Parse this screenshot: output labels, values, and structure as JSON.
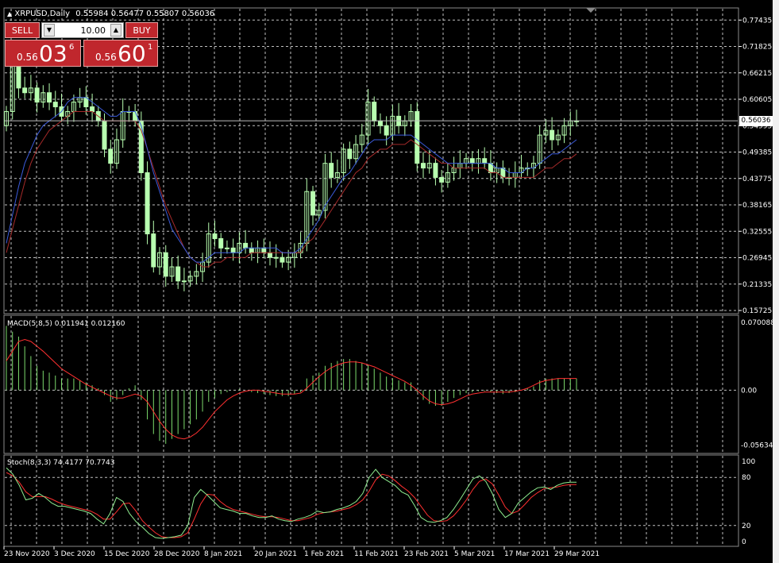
{
  "header": {
    "title": "XRPUSD,Daily",
    "ohlc": "0.55984 0.56477 0.55807 0.56036"
  },
  "trade_panel": {
    "sell_label": "SELL",
    "buy_label": "BUY",
    "volume": "10.00",
    "sell_price": {
      "small": "0.56",
      "big": "03",
      "pip": "6"
    },
    "buy_price": {
      "small": "0.56",
      "big": "60",
      "pip": "1"
    }
  },
  "colors": {
    "background": "#000000",
    "grid": "#ffffff",
    "bull_candle": "#b8ffb0",
    "wick": "#ffffff",
    "ma_fast": "#3b5bdb",
    "ma_slow": "#a52a2a",
    "histogram": "#7ddc6d",
    "signal": "#ff3030",
    "stoch_main": "#90ee90",
    "stoch_signal": "#ff3030",
    "trade_red": "#c0272d"
  },
  "current_price_label": "0.56036",
  "chart_data": [
    {
      "type": "candlestick",
      "title": "XRPUSD,Daily",
      "ylim": [
        0.15725,
        0.79
      ],
      "y_ticks": [
        "0.77435",
        "0.71825",
        "0.66215",
        "0.60605",
        "0.54995",
        "0.49385",
        "0.43775",
        "0.38165",
        "0.32555",
        "0.26945",
        "0.21335",
        "0.15725"
      ],
      "y_tick_values": [
        0.77435,
        0.71825,
        0.66215,
        0.60605,
        0.54995,
        0.49385,
        0.43775,
        0.38165,
        0.32555,
        0.26945,
        0.21335,
        0.15725
      ],
      "current_price": 0.56036,
      "x_labels": [
        "23 Nov 2020",
        "3 Dec 2020",
        "15 Dec 2020",
        "28 Dec 2020",
        "8 Jan 2021",
        "20 Jan 2021",
        "1 Feb 2021",
        "11 Feb 2021",
        "23 Feb 2021",
        "5 Mar 2021",
        "17 Mar 2021",
        "29 Mar 2021"
      ],
      "close": [
        0.58,
        0.68,
        0.63,
        0.62,
        0.63,
        0.6,
        0.62,
        0.6,
        0.59,
        0.57,
        0.58,
        0.6,
        0.61,
        0.59,
        0.58,
        0.56,
        0.5,
        0.47,
        0.52,
        0.58,
        0.58,
        0.56,
        0.45,
        0.32,
        0.25,
        0.28,
        0.23,
        0.25,
        0.22,
        0.22,
        0.23,
        0.24,
        0.26,
        0.32,
        0.31,
        0.29,
        0.29,
        0.28,
        0.3,
        0.29,
        0.28,
        0.29,
        0.28,
        0.27,
        0.27,
        0.26,
        0.27,
        0.28,
        0.3,
        0.41,
        0.36,
        0.37,
        0.47,
        0.44,
        0.45,
        0.5,
        0.48,
        0.51,
        0.53,
        0.6,
        0.56,
        0.55,
        0.53,
        0.57,
        0.55,
        0.56,
        0.58,
        0.47,
        0.46,
        0.47,
        0.44,
        0.43,
        0.45,
        0.46,
        0.47,
        0.48,
        0.47,
        0.48,
        0.47,
        0.45,
        0.46,
        0.44,
        0.44,
        0.45,
        0.46,
        0.46,
        0.47,
        0.53,
        0.54,
        0.52,
        0.53,
        0.55,
        0.56,
        0.56
      ],
      "ma_fast": [
        0.3,
        0.36,
        0.42,
        0.47,
        0.5,
        0.53,
        0.55,
        0.56,
        0.57,
        0.58,
        0.6,
        0.61,
        0.61,
        0.61,
        0.6,
        0.59,
        0.58,
        0.57,
        0.57,
        0.58,
        0.58,
        0.58,
        0.55,
        0.5,
        0.45,
        0.41,
        0.37,
        0.33,
        0.31,
        0.29,
        0.27,
        0.26,
        0.26,
        0.27,
        0.28,
        0.28,
        0.28,
        0.28,
        0.28,
        0.29,
        0.29,
        0.29,
        0.29,
        0.29,
        0.29,
        0.28,
        0.28,
        0.28,
        0.29,
        0.31,
        0.33,
        0.35,
        0.38,
        0.4,
        0.42,
        0.44,
        0.45,
        0.47,
        0.49,
        0.51,
        0.52,
        0.52,
        0.52,
        0.53,
        0.53,
        0.53,
        0.53,
        0.52,
        0.51,
        0.5,
        0.49,
        0.48,
        0.47,
        0.47,
        0.47,
        0.47,
        0.47,
        0.47,
        0.47,
        0.47,
        0.46,
        0.46,
        0.45,
        0.45,
        0.45,
        0.46,
        0.46,
        0.47,
        0.48,
        0.49,
        0.49,
        0.5,
        0.51,
        0.52
      ],
      "ma_slow": [
        0.28,
        0.33,
        0.38,
        0.43,
        0.47,
        0.5,
        0.52,
        0.54,
        0.55,
        0.56,
        0.57,
        0.58,
        0.58,
        0.58,
        0.58,
        0.57,
        0.56,
        0.56,
        0.56,
        0.56,
        0.56,
        0.56,
        0.54,
        0.5,
        0.46,
        0.42,
        0.38,
        0.35,
        0.32,
        0.29,
        0.27,
        0.26,
        0.25,
        0.25,
        0.26,
        0.26,
        0.27,
        0.27,
        0.27,
        0.27,
        0.28,
        0.28,
        0.28,
        0.28,
        0.28,
        0.28,
        0.28,
        0.28,
        0.28,
        0.3,
        0.31,
        0.33,
        0.35,
        0.37,
        0.39,
        0.41,
        0.43,
        0.45,
        0.46,
        0.48,
        0.49,
        0.5,
        0.5,
        0.51,
        0.51,
        0.51,
        0.52,
        0.51,
        0.5,
        0.49,
        0.48,
        0.47,
        0.47,
        0.46,
        0.46,
        0.46,
        0.46,
        0.46,
        0.46,
        0.45,
        0.45,
        0.44,
        0.44,
        0.44,
        0.44,
        0.44,
        0.44,
        0.45,
        0.46,
        0.46,
        0.47,
        0.48,
        0.48,
        0.49
      ]
    },
    {
      "type": "bar",
      "title": "MACD(5,8,5)",
      "label": "MACD(5,8,5) 0.011941 0.012160",
      "y_ticks": [
        "0.070088",
        "0.00",
        "-0.056345"
      ],
      "y_tick_values": [
        0.070088,
        0.0,
        -0.056345
      ],
      "ylim": [
        -0.06,
        0.072
      ],
      "histogram": [
        0.066,
        0.06,
        0.055,
        0.045,
        0.035,
        0.025,
        0.02,
        0.018,
        0.015,
        0.012,
        0.012,
        0.012,
        0.01,
        0.008,
        0.005,
        0.002,
        -0.005,
        -0.012,
        -0.01,
        -0.005,
        0.002,
        0.005,
        -0.01,
        -0.03,
        -0.045,
        -0.052,
        -0.055,
        -0.05,
        -0.045,
        -0.04,
        -0.035,
        -0.03,
        -0.022,
        -0.012,
        -0.008,
        -0.004,
        -0.002,
        0.0,
        0.001,
        0.0,
        -0.002,
        -0.003,
        -0.004,
        -0.005,
        -0.006,
        -0.006,
        -0.006,
        -0.004,
        -0.002,
        0.012,
        0.015,
        0.018,
        0.025,
        0.028,
        0.03,
        0.032,
        0.032,
        0.03,
        0.028,
        0.026,
        0.022,
        0.018,
        0.014,
        0.012,
        0.01,
        0.008,
        0.008,
        -0.002,
        -0.01,
        -0.014,
        -0.016,
        -0.016,
        -0.012,
        -0.008,
        -0.005,
        -0.003,
        -0.002,
        -0.001,
        -0.001,
        -0.002,
        -0.003,
        -0.004,
        -0.003,
        -0.002,
        0.0,
        0.002,
        0.004,
        0.01,
        0.012,
        0.012,
        0.012,
        0.012,
        0.012,
        0.012
      ],
      "signal": [
        0.03,
        0.04,
        0.05,
        0.052,
        0.05,
        0.045,
        0.04,
        0.034,
        0.028,
        0.022,
        0.018,
        0.014,
        0.01,
        0.006,
        0.003,
        0.0,
        -0.003,
        -0.006,
        -0.008,
        -0.008,
        -0.006,
        -0.004,
        -0.006,
        -0.012,
        -0.022,
        -0.032,
        -0.04,
        -0.046,
        -0.049,
        -0.05,
        -0.048,
        -0.044,
        -0.038,
        -0.03,
        -0.022,
        -0.016,
        -0.01,
        -0.006,
        -0.003,
        -0.001,
        0.0,
        0.0,
        -0.001,
        -0.002,
        -0.003,
        -0.004,
        -0.004,
        -0.004,
        -0.003,
        0.002,
        0.008,
        0.014,
        0.019,
        0.023,
        0.026,
        0.028,
        0.029,
        0.029,
        0.028,
        0.026,
        0.024,
        0.021,
        0.018,
        0.015,
        0.012,
        0.009,
        0.005,
        0.0,
        -0.006,
        -0.011,
        -0.014,
        -0.015,
        -0.014,
        -0.012,
        -0.009,
        -0.006,
        -0.004,
        -0.003,
        -0.002,
        -0.002,
        -0.002,
        -0.002,
        -0.002,
        -0.001,
        0.0,
        0.002,
        0.005,
        0.008,
        0.01,
        0.011,
        0.012,
        0.012,
        0.012,
        0.012
      ]
    },
    {
      "type": "line",
      "title": "Stoch(8,3,3)",
      "label": "Stoch(8,3,3) 74.4177 70.7743",
      "y_ticks": [
        "100",
        "80",
        "20",
        "0"
      ],
      "y_tick_values": [
        100,
        80,
        20,
        0
      ],
      "ylim": [
        0,
        100
      ],
      "main": [
        92,
        84,
        70,
        52,
        54,
        60,
        55,
        48,
        44,
        44,
        42,
        40,
        38,
        35,
        28,
        22,
        35,
        55,
        50,
        35,
        25,
        18,
        10,
        5,
        4,
        5,
        6,
        8,
        20,
        55,
        65,
        58,
        50,
        42,
        40,
        38,
        35,
        35,
        32,
        30,
        30,
        32,
        28,
        26,
        25,
        28,
        30,
        33,
        38,
        36,
        37,
        40,
        42,
        45,
        50,
        60,
        80,
        90,
        80,
        75,
        70,
        62,
        58,
        45,
        30,
        25,
        24,
        26,
        30,
        40,
        52,
        65,
        78,
        82,
        75,
        60,
        40,
        30,
        35,
        48,
        55,
        62,
        67,
        68,
        65,
        70,
        73,
        74,
        74
      ],
      "signal": [
        86,
        82,
        74,
        62,
        56,
        56,
        56,
        53,
        49,
        46,
        44,
        42,
        40,
        38,
        34,
        28,
        28,
        37,
        47,
        48,
        38,
        26,
        18,
        11,
        6,
        5,
        5,
        6,
        11,
        28,
        47,
        59,
        58,
        50,
        44,
        40,
        38,
        36,
        34,
        32,
        31,
        31,
        30,
        28,
        26,
        26,
        28,
        30,
        34,
        36,
        37,
        38,
        40,
        42,
        46,
        52,
        63,
        77,
        84,
        82,
        76,
        69,
        63,
        55,
        44,
        33,
        26,
        25,
        26,
        32,
        41,
        52,
        65,
        75,
        78,
        72,
        58,
        43,
        35,
        38,
        46,
        55,
        61,
        66,
        67,
        68,
        70,
        71,
        71
      ]
    }
  ]
}
